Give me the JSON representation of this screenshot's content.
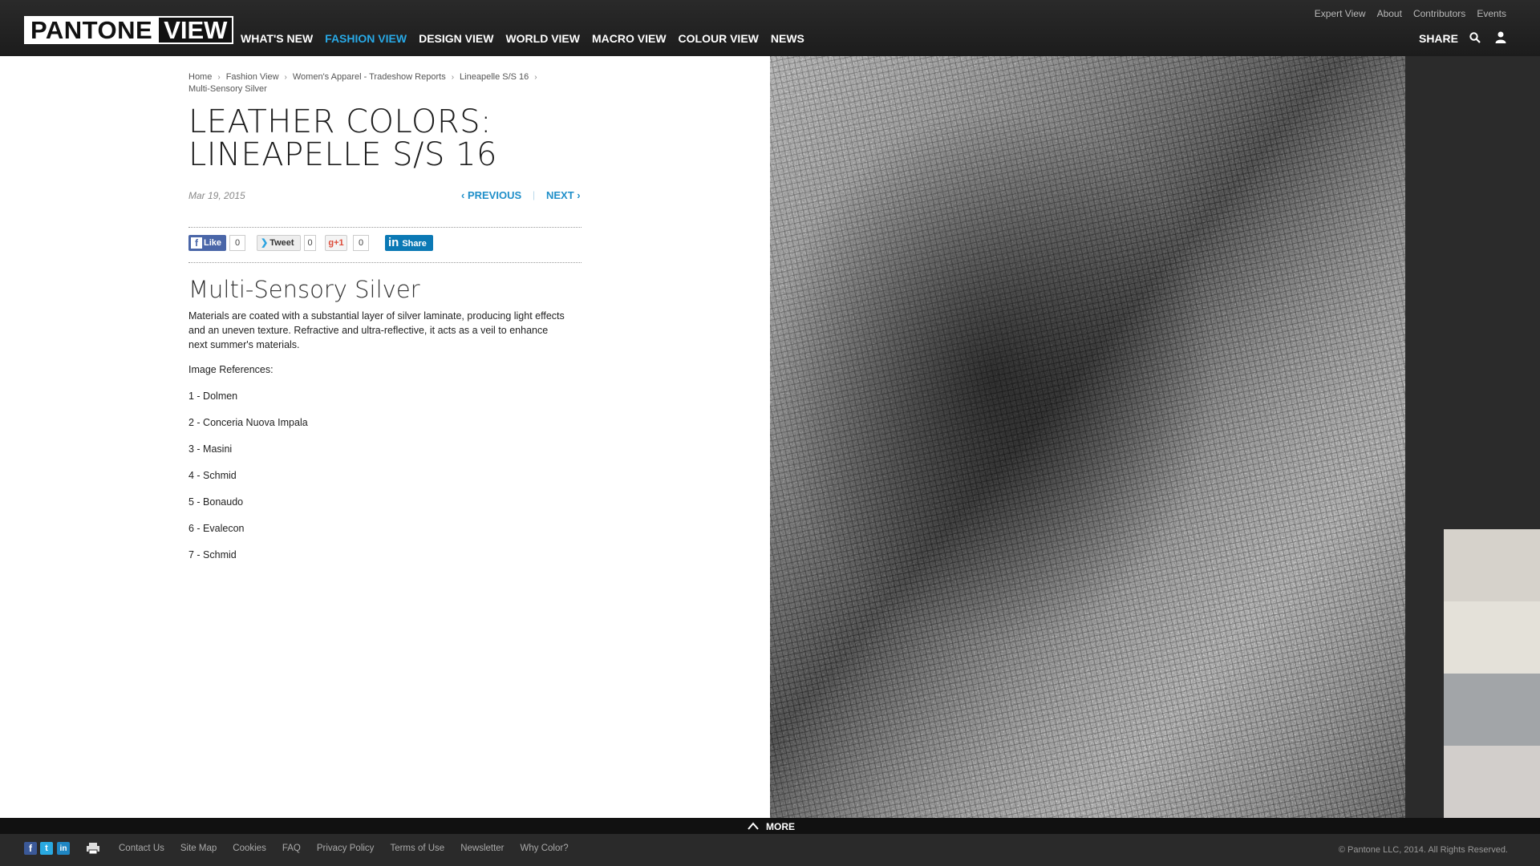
{
  "header": {
    "logo_left": "PANTONE",
    "logo_right": "VIEW",
    "nav": [
      "WHAT'S NEW",
      "FASHION VIEW",
      "DESIGN VIEW",
      "WORLD VIEW",
      "MACRO VIEW",
      "COLOUR VIEW",
      "NEWS"
    ],
    "active_nav": "FASHION VIEW",
    "top_links": [
      "Expert View",
      "About",
      "Contributors",
      "Events"
    ],
    "share_label": "SHARE",
    "accent_color": "#28a9e6"
  },
  "breadcrumb": {
    "items": [
      "Home",
      "Fashion View",
      "Women's Apparel - Tradeshow Reports",
      "Lineapelle S/S 16"
    ],
    "current": "Multi-Sensory Silver"
  },
  "article": {
    "title": "LEATHER COLORS: LINEAPELLE S/S 16",
    "date": "Mar 19, 2015",
    "previous_label": "PREVIOUS",
    "next_label": "NEXT",
    "pager_separator": "|"
  },
  "social": {
    "like_label": "Like",
    "like_count": "0",
    "tweet_label": "Tweet",
    "tweet_count": "0",
    "gplus_label": "+1",
    "gplus_count": "0",
    "linkedin_label": "Share"
  },
  "section": {
    "heading": "Multi-Sensory Silver",
    "body": "Materials are coated with a substantial layer of silver laminate, producing light effects and an uneven texture. Refractive and ultra-reflective, it acts as a veil to enhance next summer's materials.",
    "image_refs_label": "Image References:",
    "references": [
      "1 - Dolmen",
      "2 - Conceria Nuova Impala",
      "3 - Masini",
      "4 - Schmid",
      "5 - Bonaudo",
      "6 - Evalecon",
      "7 - Schmid"
    ]
  },
  "swatches": [
    "#d6d2cb",
    "#e4e1d9",
    "#a2a5a8",
    "#d2cecb"
  ],
  "footer": {
    "more_label": "MORE",
    "links": [
      "Contact Us",
      "Site Map",
      "Cookies",
      "FAQ",
      "Privacy Policy",
      "Terms of Use",
      "Newsletter",
      "Why Color?"
    ],
    "copyright": "© Pantone LLC, 2014. All Rights Reserved."
  }
}
